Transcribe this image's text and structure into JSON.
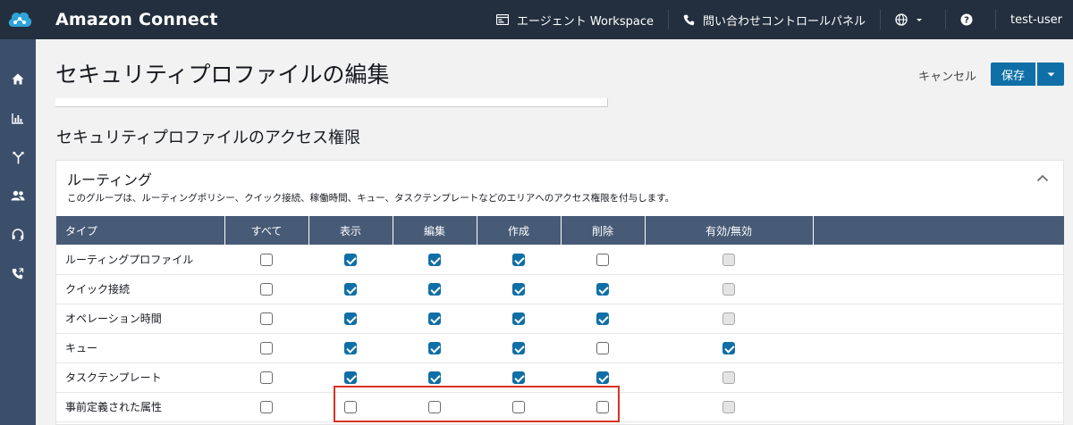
{
  "app": {
    "title": "Amazon Connect"
  },
  "topnav": {
    "workspace_label": "エージェント Workspace",
    "ccp_label": "問い合わせコントロールパネル",
    "user_label": "test-user"
  },
  "header": {
    "title": "セキュリティプロファイルの編集",
    "cancel_label": "キャンセル",
    "save_label": "保存"
  },
  "section": {
    "title": "セキュリティプロファイルのアクセス権限"
  },
  "routing": {
    "title": "ルーティング",
    "description": "このグループは、ルーティングポリシー、クイック接続、稼働時間、キュー、タスクテンプレートなどのエリアへのアクセス権限を付与します。",
    "columns": [
      "タイプ",
      "すべて",
      "表示",
      "編集",
      "作成",
      "削除",
      "有効/無効"
    ],
    "rows": [
      {
        "type": "ルーティングプロファイル",
        "all": false,
        "view": true,
        "edit": true,
        "create": true,
        "delete": false,
        "enable": false
      },
      {
        "type": "クイック接続",
        "all": false,
        "view": true,
        "edit": true,
        "create": true,
        "delete": true,
        "enable": false
      },
      {
        "type": "オペレーション時間",
        "all": false,
        "view": true,
        "edit": true,
        "create": true,
        "delete": true,
        "enable": false
      },
      {
        "type": "キュー",
        "all": false,
        "view": true,
        "edit": true,
        "create": true,
        "delete": false,
        "enable": true
      },
      {
        "type": "タスクテンプレート",
        "all": false,
        "view": true,
        "edit": true,
        "create": true,
        "delete": true,
        "enable": false
      },
      {
        "type": "事前定義された属性",
        "all": false,
        "view": false,
        "edit": false,
        "create": false,
        "delete": false,
        "enable": false
      }
    ]
  },
  "colors": {
    "topbar": "#232f3e",
    "rail": "#3b4f6b",
    "table_header": "#475a76",
    "primary": "#0f6fa6",
    "highlight": "#d93025"
  },
  "icons": [
    "amazon-connect-logo",
    "workspace-icon",
    "phone-icon",
    "globe-icon",
    "help-icon",
    "home-icon",
    "analytics-icon",
    "routing-icon",
    "users-icon",
    "headset-icon",
    "contact-phone-icon",
    "chevron-up-icon",
    "caret-down-icon"
  ]
}
